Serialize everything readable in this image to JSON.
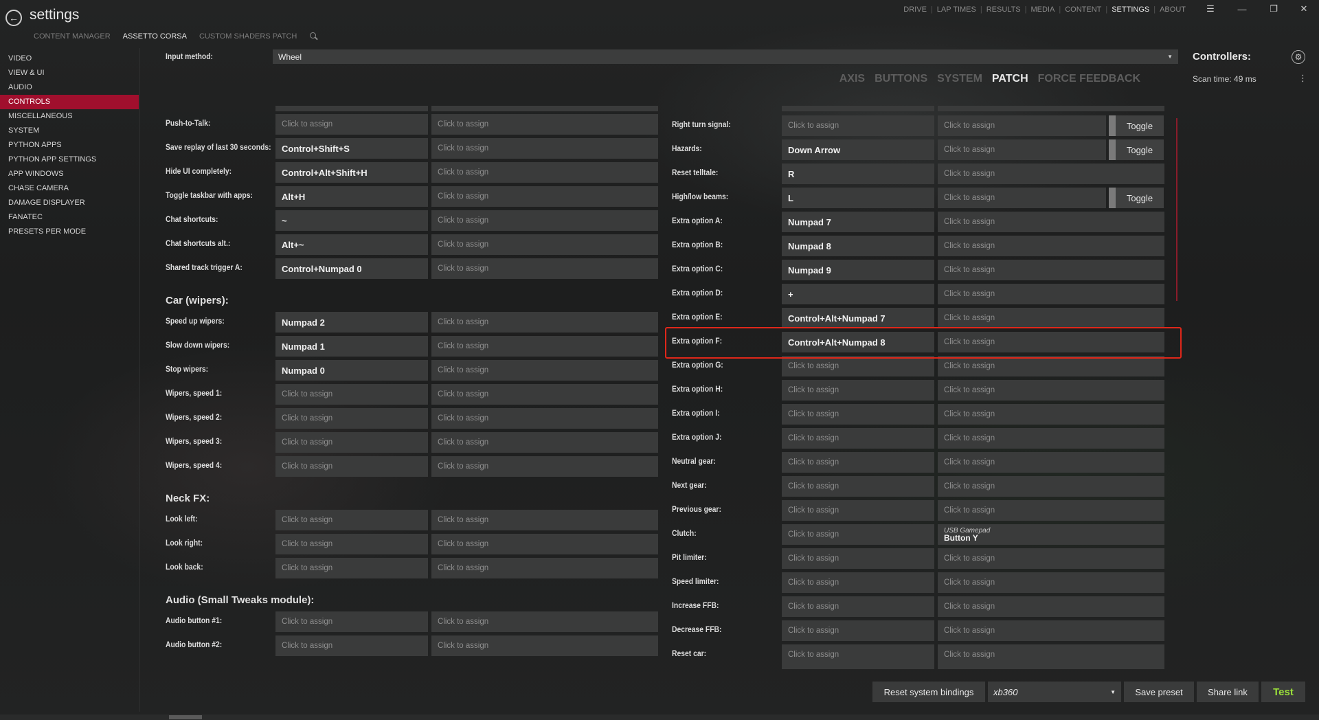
{
  "title": "settings",
  "top_nav": [
    "DRIVE",
    "LAP TIMES",
    "RESULTS",
    "MEDIA",
    "CONTENT",
    "SETTINGS",
    "ABOUT"
  ],
  "top_nav_active": "SETTINGS",
  "sub_nav": [
    "CONTENT MANAGER",
    "ASSETTO CORSA",
    "CUSTOM SHADERS PATCH"
  ],
  "sub_nav_active": "ASSETTO CORSA",
  "sidebar": [
    "VIDEO",
    "VIEW & UI",
    "AUDIO",
    "CONTROLS",
    "MISCELLANEOUS",
    "SYSTEM",
    "PYTHON APPS",
    "PYTHON APP SETTINGS",
    "APP WINDOWS",
    "CHASE CAMERA",
    "DAMAGE DISPLAYER",
    "FANATEC",
    "PRESETS PER MODE"
  ],
  "sidebar_active": "CONTROLS",
  "input_method": {
    "label": "Input method:",
    "value": "Wheel"
  },
  "tabs": [
    "AXIS",
    "BUTTONS",
    "SYSTEM",
    "PATCH",
    "FORCE FEEDBACK"
  ],
  "tabs_active": "PATCH",
  "controllers": {
    "title": "Controllers:",
    "scan_time": "Scan time: 49 ms"
  },
  "placeholder": "Click to assign",
  "left_column": [
    {
      "type": "row",
      "label": "Push-to-Talk:",
      "b1": "",
      "b2": ""
    },
    {
      "type": "row",
      "label": "Save replay of last 30 seconds:",
      "b1": "Control+Shift+S",
      "b2": ""
    },
    {
      "type": "row",
      "label": "Hide UI completely:",
      "b1": "Control+Alt+Shift+H",
      "b2": ""
    },
    {
      "type": "row",
      "label": "Toggle taskbar with apps:",
      "b1": "Alt+H",
      "b2": ""
    },
    {
      "type": "row",
      "label": "Chat shortcuts:",
      "b1": "~",
      "b2": ""
    },
    {
      "type": "row",
      "label": "Chat shortcuts alt.:",
      "b1": "Alt+~",
      "b2": ""
    },
    {
      "type": "row",
      "label": "Shared track trigger A:",
      "b1": "Control+Numpad 0",
      "b2": ""
    },
    {
      "type": "section",
      "label": "Car (wipers):"
    },
    {
      "type": "row",
      "label": "Speed up wipers:",
      "b1": "Numpad 2",
      "b2": ""
    },
    {
      "type": "row",
      "label": "Slow down wipers:",
      "b1": "Numpad 1",
      "b2": ""
    },
    {
      "type": "row",
      "label": "Stop wipers:",
      "b1": "Numpad 0",
      "b2": ""
    },
    {
      "type": "row",
      "label": "Wipers, speed 1:",
      "b1": "",
      "b2": ""
    },
    {
      "type": "row",
      "label": "Wipers, speed 2:",
      "b1": "",
      "b2": ""
    },
    {
      "type": "row",
      "label": "Wipers, speed 3:",
      "b1": "",
      "b2": ""
    },
    {
      "type": "row",
      "label": "Wipers, speed 4:",
      "b1": "",
      "b2": ""
    },
    {
      "type": "section",
      "label": "Neck FX:"
    },
    {
      "type": "row",
      "label": "Look left:",
      "b1": "",
      "b2": ""
    },
    {
      "type": "row",
      "label": "Look right:",
      "b1": "",
      "b2": ""
    },
    {
      "type": "row",
      "label": "Look back:",
      "b1": "",
      "b2": ""
    },
    {
      "type": "section",
      "label": "Audio (Small Tweaks module):"
    },
    {
      "type": "row",
      "label": "Audio button #1:",
      "b1": "",
      "b2": ""
    },
    {
      "type": "row",
      "label": "Audio button #2:",
      "b1": "",
      "b2": ""
    }
  ],
  "right_column": [
    {
      "label": "Right turn signal:",
      "b1": "",
      "b2": "",
      "toggle": "Toggle"
    },
    {
      "label": "Hazards:",
      "b1": "Down Arrow",
      "b2": "",
      "toggle": "Toggle"
    },
    {
      "label": "Reset telltale:",
      "b1": "R",
      "b2": ""
    },
    {
      "label": "High/low beams:",
      "b1": "L",
      "b2": "",
      "toggle": "Toggle"
    },
    {
      "label": "Extra option A:",
      "b1": "Numpad 7",
      "b2": ""
    },
    {
      "label": "Extra option B:",
      "b1": "Numpad 8",
      "b2": ""
    },
    {
      "label": "Extra option C:",
      "b1": "Numpad 9",
      "b2": ""
    },
    {
      "label": "Extra option D:",
      "b1": "+",
      "b2": ""
    },
    {
      "label": "Extra option E:",
      "b1": "Control+Alt+Numpad 7",
      "b2": ""
    },
    {
      "label": "Extra option F:",
      "b1": "Control+Alt+Numpad 8",
      "b2": ""
    },
    {
      "label": "Extra option G:",
      "b1": "",
      "b2": ""
    },
    {
      "label": "Extra option H:",
      "b1": "",
      "b2": ""
    },
    {
      "label": "Extra option I:",
      "b1": "",
      "b2": ""
    },
    {
      "label": "Extra option J:",
      "b1": "",
      "b2": ""
    },
    {
      "label": "Neutral gear:",
      "b1": "",
      "b2": ""
    },
    {
      "label": "Next gear:",
      "b1": "",
      "b2": ""
    },
    {
      "label": "Previous gear:",
      "b1": "",
      "b2": ""
    },
    {
      "label": "Clutch:",
      "b1": "",
      "b2_device": "USB Gamepad",
      "b2_button": "Button Y"
    },
    {
      "label": "Pit limiter:",
      "b1": "",
      "b2": ""
    },
    {
      "label": "Speed limiter:",
      "b1": "",
      "b2": ""
    },
    {
      "label": "Increase FFB:",
      "b1": "",
      "b2": ""
    },
    {
      "label": "Decrease FFB:",
      "b1": "",
      "b2": ""
    },
    {
      "label": "Reset car:",
      "b1": "",
      "b2": ""
    }
  ],
  "bottom": {
    "reset": "Reset system bindings",
    "preset": "xb360",
    "save": "Save preset",
    "share": "Share link",
    "test": "Test"
  }
}
